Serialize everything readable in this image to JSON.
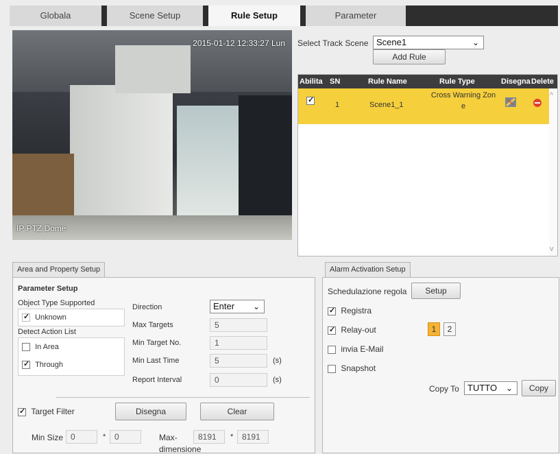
{
  "tabs": [
    {
      "label": "Globala"
    },
    {
      "label": "Scene Setup"
    },
    {
      "label": "Rule Setup"
    },
    {
      "label": "Parameter"
    }
  ],
  "active_tab": "Rule Setup",
  "video": {
    "timestamp": "2015-01-12 12:33:27 Lun",
    "camera_name": "IP PTZ Dome"
  },
  "track_scene": {
    "label": "Select Track Scene",
    "selected": "Scene1",
    "add_rule_label": "Add Rule"
  },
  "rule_table": {
    "headers": [
      "Abilita",
      "SN",
      "Rule Name",
      "Rule Type",
      "Disegna",
      "Delete"
    ],
    "rows": [
      {
        "enabled": true,
        "sn": "1",
        "name": "Scene1_1",
        "type_line1": "Cross Warning Zon",
        "type_line2": "e"
      }
    ],
    "scroll_up": "^",
    "scroll_down": "v"
  },
  "area_setup": {
    "title": "Area and Property Setup",
    "param_title": "Parameter Setup",
    "object_type_label": "Object Type Supported",
    "object_unknown": "Unknown",
    "detect_action_label": "Detect Action List",
    "action_in_area": "In Area",
    "action_through": "Through",
    "direction_label": "Direction",
    "direction_value": "Enter",
    "max_targets_label": "Max Targets",
    "max_targets_value": "5",
    "min_target_label": "Min Target No.",
    "min_target_value": "1",
    "min_last_label": "Min Last Time",
    "min_last_value": "5",
    "min_last_unit": "(s)",
    "report_label": "Report Interval",
    "report_value": "0",
    "report_unit": "(s)",
    "target_filter_label": "Target Filter",
    "disegna_label": "Disegna",
    "clear_label": "Clear",
    "min_size_label": "Min Size",
    "min_w": "0",
    "min_h": "0",
    "times": "*",
    "max_label": "Max-",
    "max_label2": "dimensione",
    "max_w": "8191",
    "max_h": "8191"
  },
  "alarm_setup": {
    "title": "Alarm Activation Setup",
    "schedule_label": "Schedulazione regola",
    "setup_label": "Setup",
    "registra_label": "Registra",
    "relay_label": "Relay-out",
    "relay_1": "1",
    "relay_2": "2",
    "email_label": "invia E-Mail",
    "snapshot_label": "Snapshot",
    "copy_to_label": "Copy To",
    "copy_to_value": "TUTTO",
    "copy_label": "Copy"
  },
  "colors": {
    "selected_row": "#f5cf3c",
    "header_dark": "#3d3d3d",
    "relay_active": "#f5b335"
  }
}
